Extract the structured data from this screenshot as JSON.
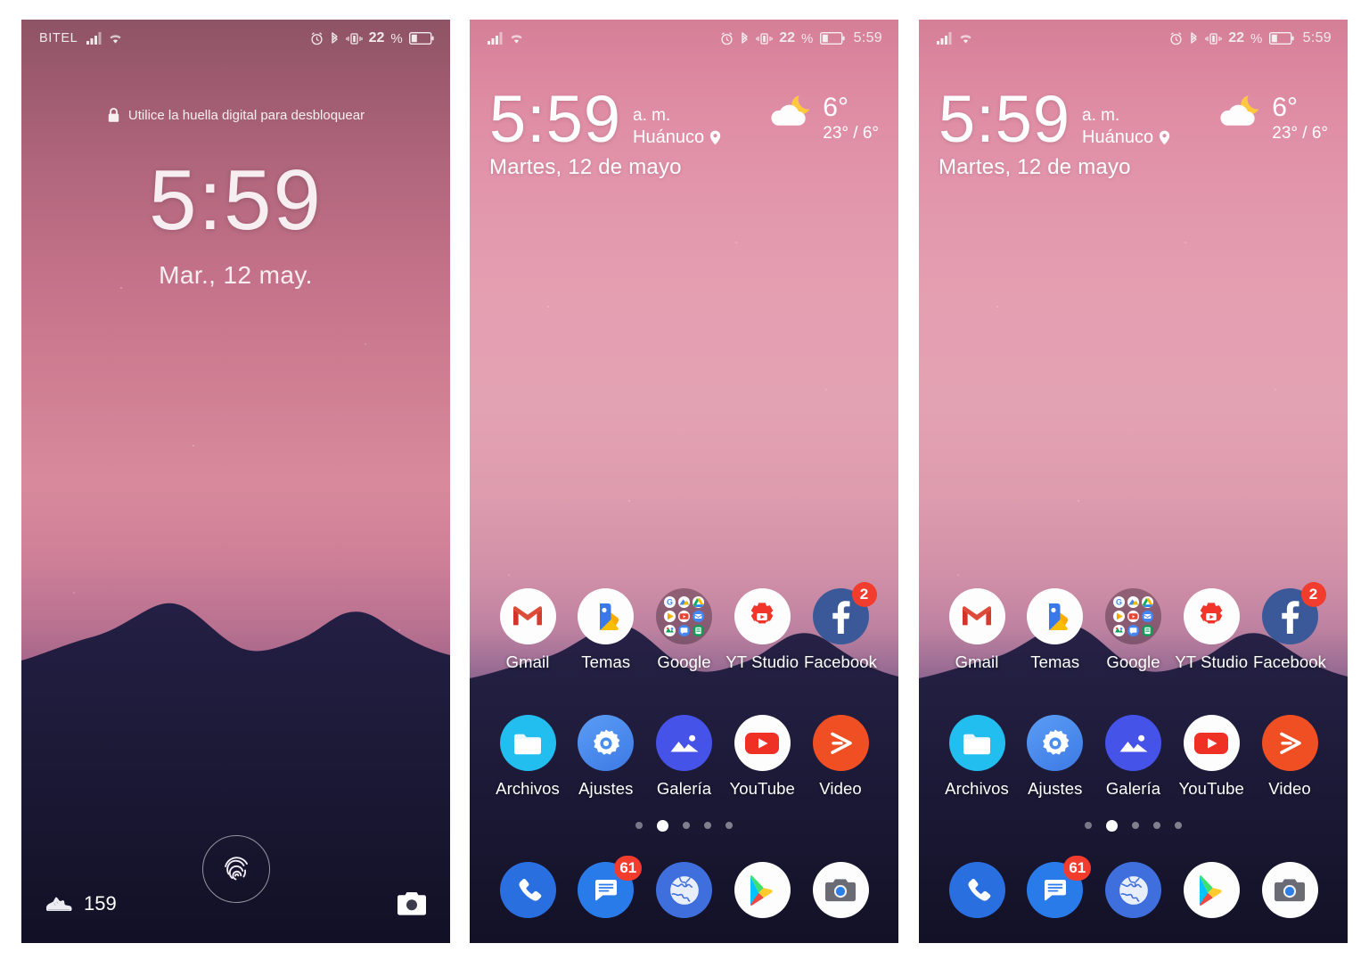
{
  "panels": [
    {
      "id": "lock-screen",
      "type": "lockscreen",
      "statusbar": {
        "carrier": "BITEL",
        "icons_left": [
          "signal-icon",
          "wifi-icon"
        ],
        "icons_right": [
          "alarm-icon",
          "bluetooth-icon",
          "vibrate-icon"
        ],
        "battery_percent": "22",
        "percent_sign": "%",
        "battery_icon": "battery-icon",
        "clock": ""
      },
      "hint": {
        "icon": "lock-icon",
        "text": "Utilice la huella digital para desbloquear"
      },
      "clock": {
        "time": "5:59",
        "date": "Mar., 12 may."
      },
      "fingerprint": {
        "icon": "fingerprint-icon"
      },
      "steps": {
        "icon": "shoe-icon",
        "count": "159"
      },
      "camera": {
        "icon": "camera-icon"
      }
    },
    {
      "id": "home-screen-1",
      "type": "homescreen",
      "statusbar": {
        "carrier": "",
        "icons_left": [
          "signal-icon",
          "wifi-icon"
        ],
        "icons_right": [
          "alarm-icon",
          "bluetooth-icon",
          "vibrate-icon"
        ],
        "battery_percent": "22",
        "percent_sign": "%",
        "battery_icon": "battery-icon",
        "clock": "5:59"
      },
      "widget": {
        "time": "5:59",
        "ampm": "a. m.",
        "city": "Huánuco",
        "city_icon": "location-pin-icon",
        "date": "Martes, 12 de mayo",
        "weather_icon": "moon-cloud-icon",
        "temp": "6°",
        "range": "23° / 6°"
      },
      "rows": [
        [
          {
            "label": "Gmail",
            "icon": "gmail-icon",
            "badge": ""
          },
          {
            "label": "Temas",
            "icon": "themes-icon",
            "badge": ""
          },
          {
            "label": "Google",
            "icon": "google-folder-icon",
            "badge": ""
          },
          {
            "label": "YT Studio",
            "icon": "yt-studio-icon",
            "badge": ""
          },
          {
            "label": "Facebook",
            "icon": "facebook-icon",
            "badge": "2"
          }
        ],
        [
          {
            "label": "Archivos",
            "icon": "files-icon",
            "badge": ""
          },
          {
            "label": "Ajustes",
            "icon": "settings-icon",
            "badge": ""
          },
          {
            "label": "Galería",
            "icon": "gallery-icon",
            "badge": ""
          },
          {
            "label": "YouTube",
            "icon": "youtube-icon",
            "badge": ""
          },
          {
            "label": "Video",
            "icon": "video-icon",
            "badge": ""
          }
        ]
      ],
      "dock": [
        {
          "label": "",
          "icon": "phone-icon",
          "badge": ""
        },
        {
          "label": "",
          "icon": "messages-icon",
          "badge": "61"
        },
        {
          "label": "",
          "icon": "browser-icon",
          "badge": ""
        },
        {
          "label": "",
          "icon": "play-store-icon",
          "badge": ""
        },
        {
          "label": "",
          "icon": "camera-app-icon",
          "badge": ""
        }
      ],
      "pager": {
        "count": 5,
        "active_index": 1
      }
    },
    {
      "id": "home-screen-2",
      "type": "homescreen",
      "statusbar": {
        "carrier": "",
        "icons_left": [
          "signal-icon",
          "wifi-icon"
        ],
        "icons_right": [
          "alarm-icon",
          "bluetooth-icon",
          "vibrate-icon"
        ],
        "battery_percent": "22",
        "percent_sign": "%",
        "battery_icon": "battery-icon",
        "clock": "5:59"
      },
      "widget": {
        "time": "5:59",
        "ampm": "a. m.",
        "city": "Huánuco",
        "city_icon": "location-pin-icon",
        "date": "Martes, 12 de mayo",
        "weather_icon": "moon-cloud-icon",
        "temp": "6°",
        "range": "23° / 6°"
      },
      "rows": [
        [
          {
            "label": "Gmail",
            "icon": "gmail-icon",
            "badge": ""
          },
          {
            "label": "Temas",
            "icon": "themes-icon",
            "badge": ""
          },
          {
            "label": "Google",
            "icon": "google-folder-icon",
            "badge": ""
          },
          {
            "label": "YT Studio",
            "icon": "yt-studio-icon",
            "badge": ""
          },
          {
            "label": "Facebook",
            "icon": "facebook-icon",
            "badge": "2"
          }
        ],
        [
          {
            "label": "Archivos",
            "icon": "files-icon",
            "badge": ""
          },
          {
            "label": "Ajustes",
            "icon": "settings-icon",
            "badge": ""
          },
          {
            "label": "Galería",
            "icon": "gallery-icon",
            "badge": ""
          },
          {
            "label": "YouTube",
            "icon": "youtube-icon",
            "badge": ""
          },
          {
            "label": "Video",
            "icon": "video-icon",
            "badge": ""
          }
        ]
      ],
      "dock": [
        {
          "label": "",
          "icon": "phone-icon",
          "badge": ""
        },
        {
          "label": "",
          "icon": "messages-icon",
          "badge": "61"
        },
        {
          "label": "",
          "icon": "browser-icon",
          "badge": ""
        },
        {
          "label": "",
          "icon": "play-store-icon",
          "badge": ""
        },
        {
          "label": "",
          "icon": "camera-app-icon",
          "badge": ""
        }
      ],
      "pager": {
        "count": 5,
        "active_index": 1
      }
    }
  ],
  "colors": {
    "badge_red": "#f23c2e",
    "facebook_blue": "#3b5998",
    "gmail_red": "#e0483b",
    "files_cyan": "#2fb8ef",
    "settings_blue": "#4a8ef0",
    "gallery_blue": "#4555e8",
    "youtube_red": "#ee3124",
    "video_orange": "#f04e23",
    "phone_blue": "#2a6fe0",
    "messages_blue": "#2a7bea",
    "browser_blue": "#3f6fdd"
  }
}
